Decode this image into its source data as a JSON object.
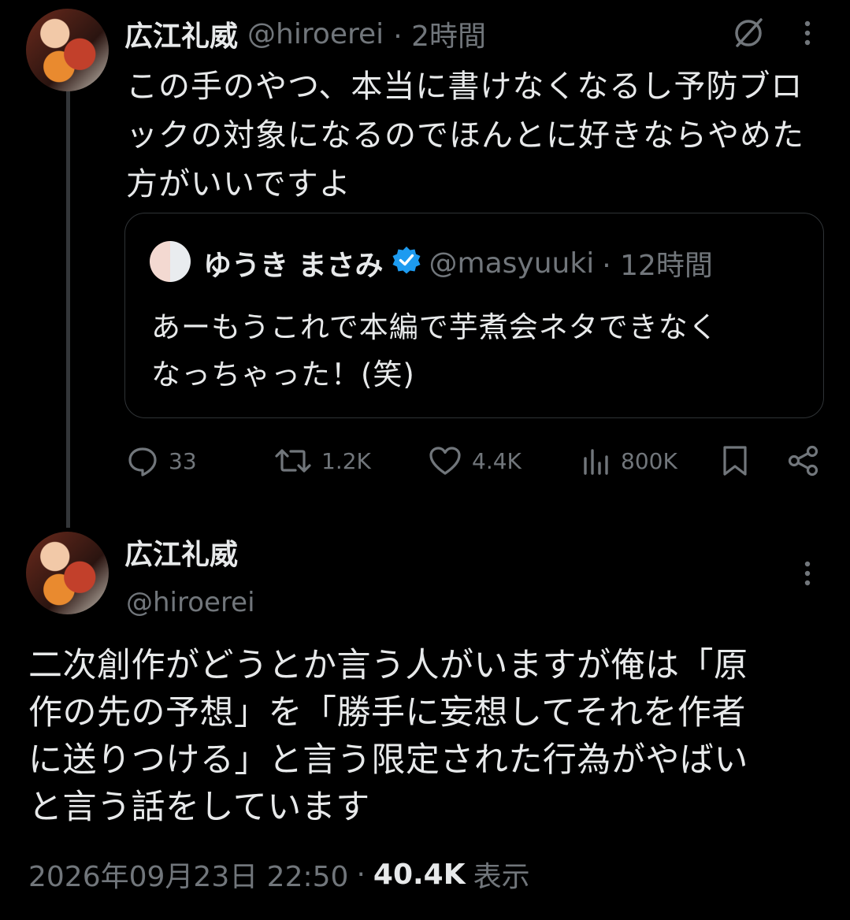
{
  "reply_tweet": {
    "author_name": "広江礼威",
    "handle": "@hiroerei",
    "time": "· 2時間",
    "text_lines": [
      "この手のやつ、本当に書けなくなるし予防ブロ",
      "ックの対象になるのでほんとに好きならやめた",
      "方がいいですよ"
    ],
    "quoted": {
      "author_name": "ゆうき まさみ",
      "handle": "@masyuuki",
      "time": "· 12時間",
      "text_lines": [
        "あーもうこれで本編で芋煮会ネタできなく",
        "なっちゃった！(笑)"
      ]
    },
    "actions": {
      "replies": "33",
      "retweets": "1.2K",
      "likes": "4.4K",
      "views": "800K"
    }
  },
  "main_tweet": {
    "author_name": "広江礼威",
    "handle": "@hiroerei",
    "text_lines": [
      "二次創作がどうとか言う人がいますが俺は「原",
      "作の先の予想」を「勝手に妄想してそれを作者",
      "に送りつける」と言う限定された行為がやばい",
      "と言う話をしています"
    ],
    "timestamp": "2026年09月23日 22:50",
    "separator": "·",
    "views": "40.4K",
    "views_label": "表示"
  },
  "colors": {
    "background": "#000000",
    "text": "#e7e9ea",
    "muted": "#71767b",
    "verified": "#1d9bf0"
  }
}
